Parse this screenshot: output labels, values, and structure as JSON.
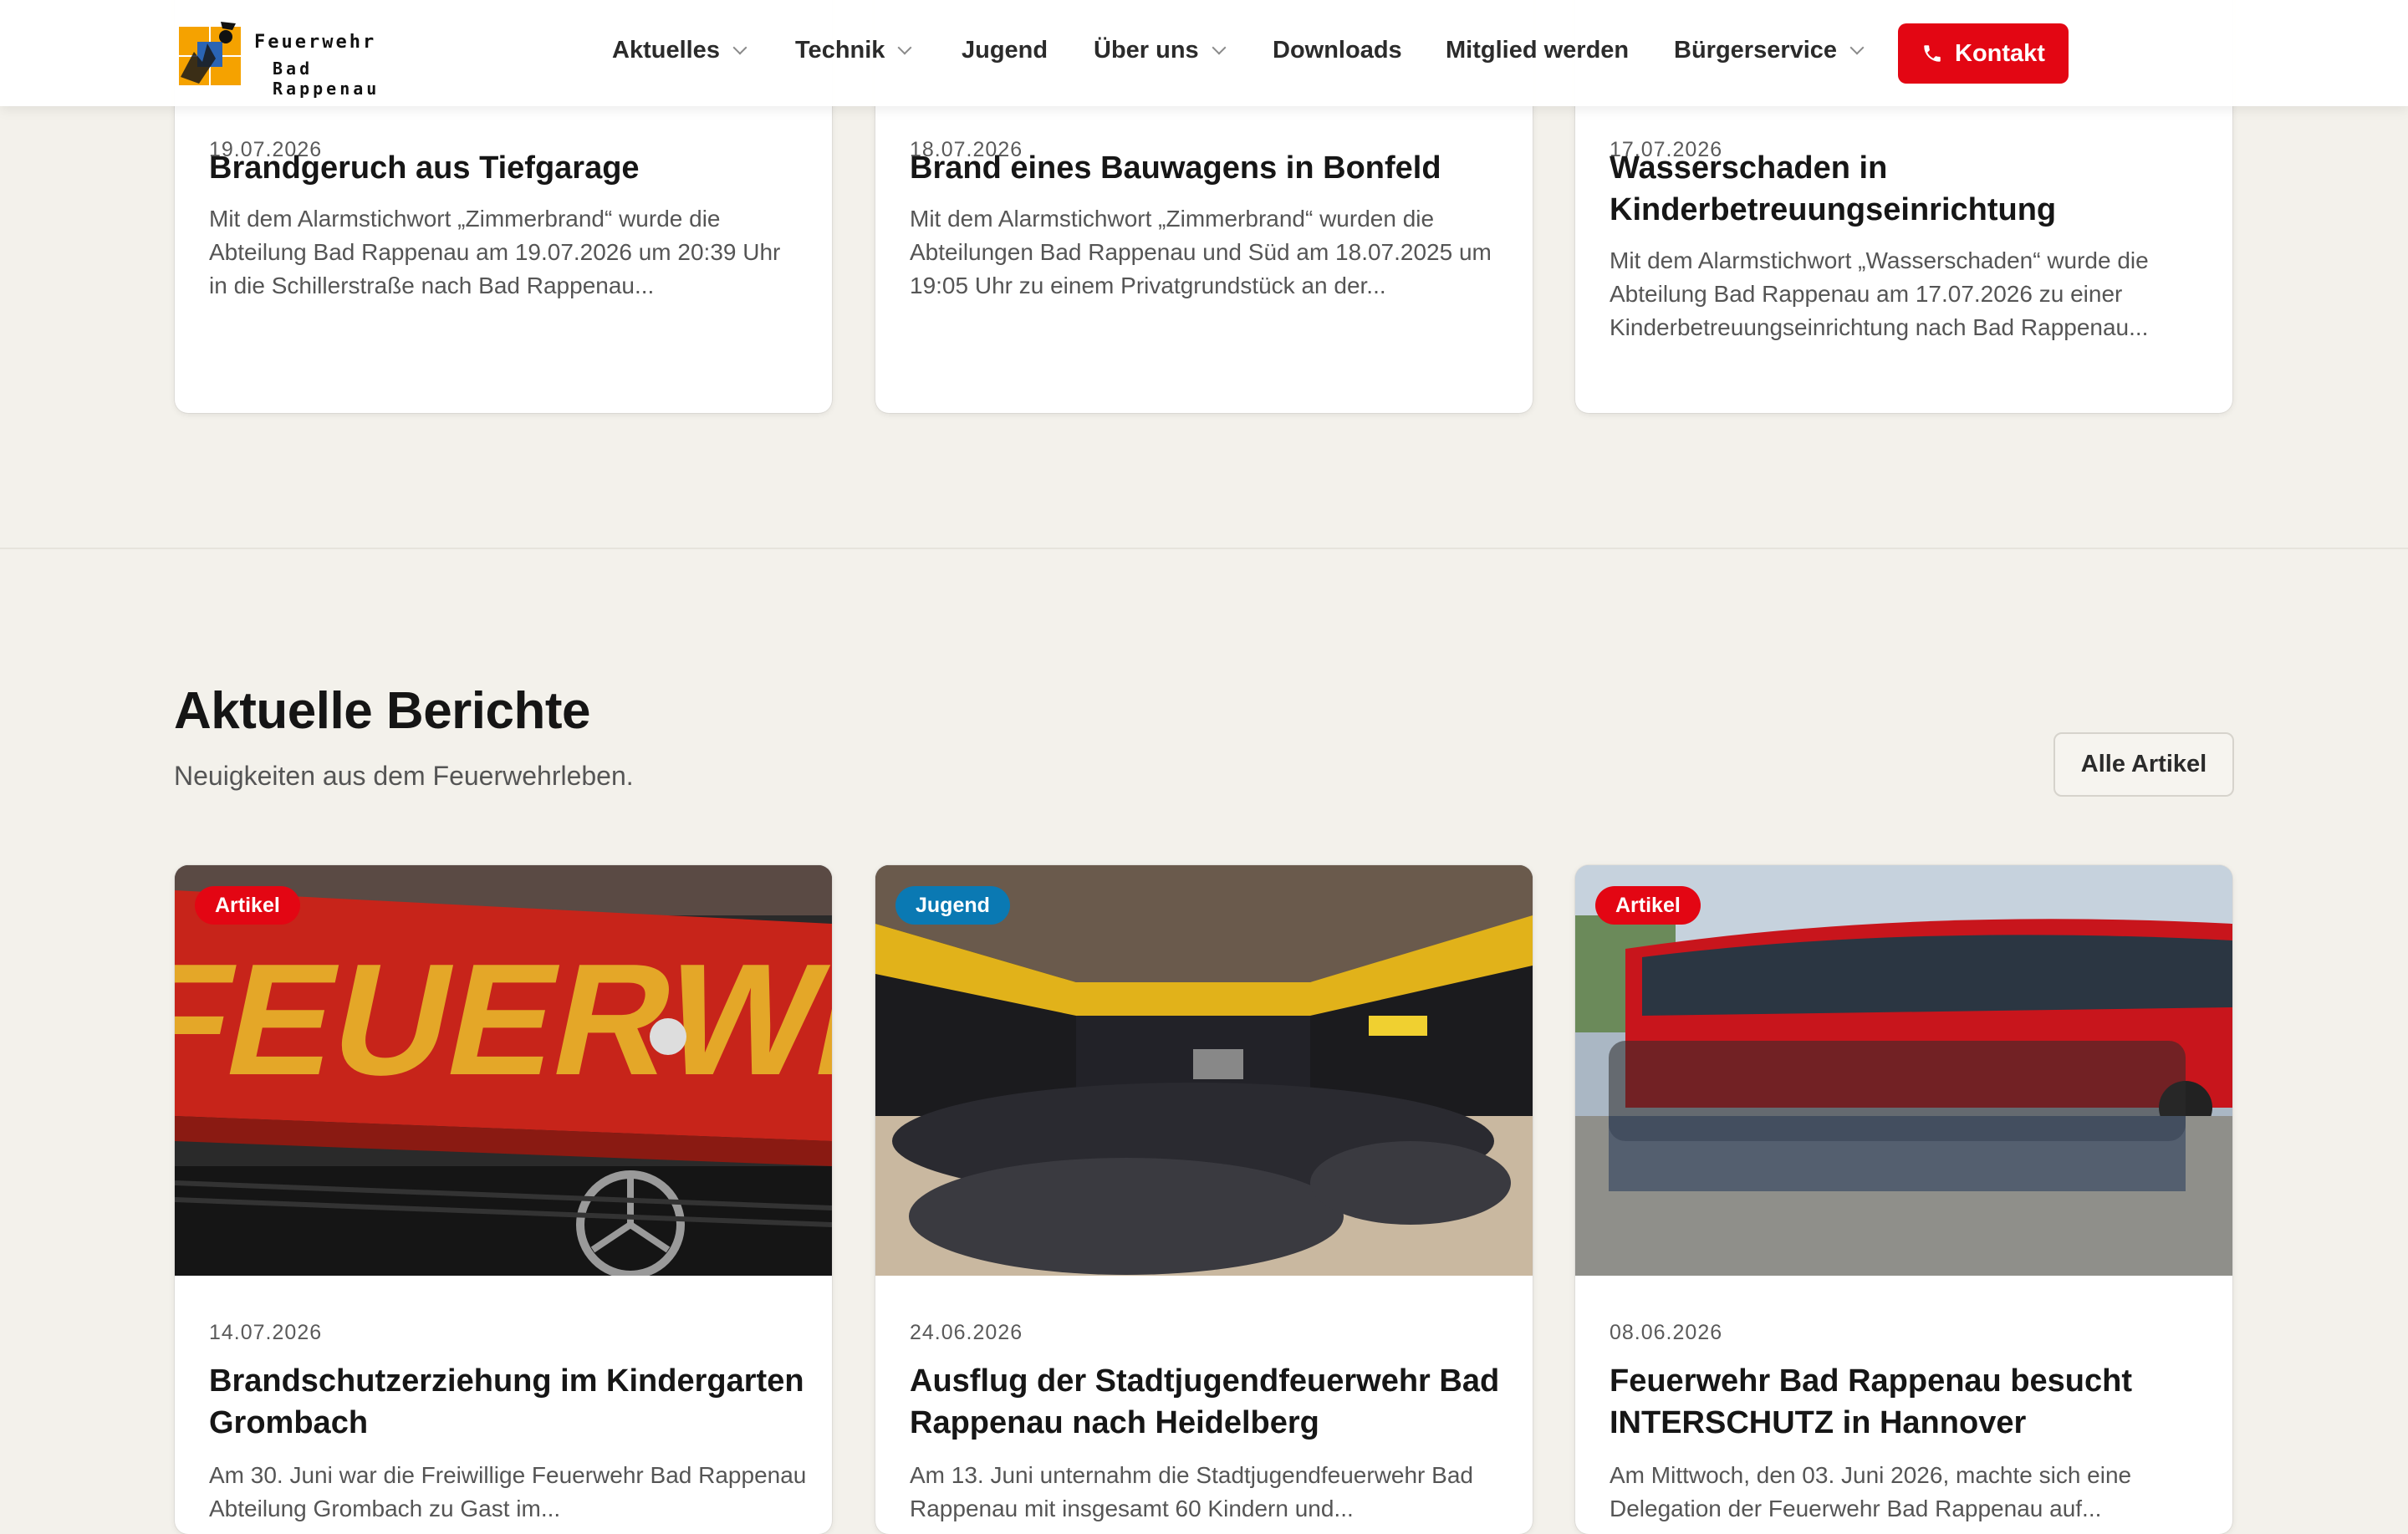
{
  "header": {
    "logo_line1": "Feuerwehr",
    "logo_line2": "Bad Rappenau",
    "nav": [
      {
        "label": "Aktuelles",
        "has_dropdown": true
      },
      {
        "label": "Technik",
        "has_dropdown": true
      },
      {
        "label": "Jugend",
        "has_dropdown": false
      },
      {
        "label": "Über uns",
        "has_dropdown": true
      },
      {
        "label": "Downloads",
        "has_dropdown": false
      },
      {
        "label": "Mitglied werden",
        "has_dropdown": false
      },
      {
        "label": "Bürgerservice",
        "has_dropdown": true
      }
    ],
    "contact_label": "Kontakt",
    "accent_color": "#e30613"
  },
  "top_cards": [
    {
      "date": "19.07.2026",
      "title": "Brandgeruch aus Tiefgarage",
      "excerpt": "Mit dem Alarmstichwort „Zimmerbrand“ wurde die Abteilung Bad Rappenau am 19.07.2026 um 20:39 Uhr in die Schillerstraße nach Bad Rappenau..."
    },
    {
      "date": "18.07.2026",
      "title": "Brand eines Bauwagens in Bonfeld",
      "excerpt": "Mit dem Alarmstichwort „Zimmerbrand“ wurden die Abteilungen Bad Rappenau und Süd am 18.07.2025 um 19:05 Uhr zu einem Privatgrundstück an der..."
    },
    {
      "date": "17.07.2026",
      "title": "Wasserschaden in Kinderbetreuungseinrichtung",
      "excerpt": "Mit dem Alarmstichwort „Wasserschaden“ wurde die Abteilung Bad Rappenau am 17.07.2026 zu einer Kinderbetreuungseinrichtung nach Bad Rappenau..."
    }
  ],
  "section": {
    "title": "Aktuelle Berichte",
    "subtitle": "Neuigkeiten aus dem Feuerwehrleben.",
    "all_button": "Alle Artikel"
  },
  "articles": [
    {
      "badge": "Artikel",
      "badge_color": "red",
      "image_icon": "fire-truck-photo",
      "image_text": "FEUERWEH",
      "date": "14.07.2026",
      "title": "Brandschutzerziehung im Kindergarten Grombach",
      "excerpt": "Am 30. Juni war die Freiwillige Feuerwehr Bad Rappenau Abteilung Grombach zu Gast im..."
    },
    {
      "badge": "Jugend",
      "badge_color": "blue",
      "image_icon": "youth-group-hall-photo",
      "date": "24.06.2026",
      "title": "Ausflug der Stadtjugendfeuerwehr Bad Rappenau nach Heidelberg",
      "excerpt": "Am 13. Juni unternahm die Stadtjugendfeuerwehr Bad Rappenau mit insgesamt 60 Kindern und..."
    },
    {
      "badge": "Artikel",
      "badge_color": "red",
      "image_icon": "group-bus-photo",
      "date": "08.06.2026",
      "title": "Feuerwehr Bad Rappenau besucht INTERSCHUTZ in Hannover",
      "excerpt": "Am Mittwoch, den 03. Juni 2026, machte sich eine Delegation der Feuerwehr Bad Rappenau auf..."
    }
  ]
}
